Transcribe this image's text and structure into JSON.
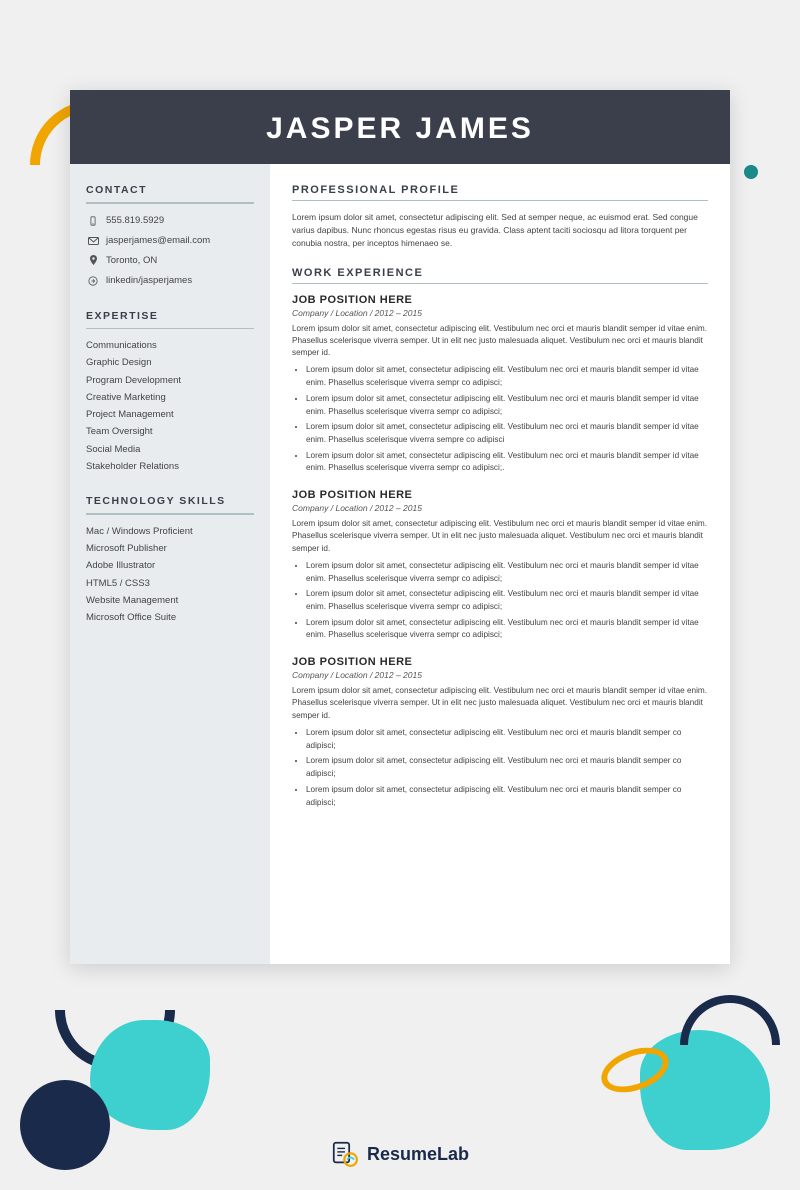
{
  "header": {
    "name": "JASPER JAMES"
  },
  "sidebar": {
    "contact_title": "CONTACT",
    "contact_items": [
      {
        "icon": "phone",
        "text": "555.819.5929"
      },
      {
        "icon": "email",
        "text": "jasperjames@email.com"
      },
      {
        "icon": "location",
        "text": "Toronto, ON"
      },
      {
        "icon": "linkedin",
        "text": "linkedin/jasperjames"
      }
    ],
    "expertise_title": "EXPERTISE",
    "expertise_items": [
      "Communications",
      "Graphic Design",
      "Program Development",
      "Creative Marketing",
      "Project Management",
      "Team Oversight",
      "Social Media",
      "Stakeholder Relations"
    ],
    "tech_title": "TECHNOLOGY SKILLS",
    "tech_items": [
      "Mac / Windows Proficient",
      "Microsoft Publisher",
      "Adobe Illustrator",
      "HTML5 / CSS3",
      "Website Management",
      "Microsoft Office Suite"
    ]
  },
  "main": {
    "profile_title": "PROFESSIONAL PROFILE",
    "profile_text": "Lorem ipsum dolor sit amet, consectetur adipiscing elit. Sed at semper neque, ac euismod erat. Sed congue varius dapibus. Nunc rhoncus egestas risus eu gravida. Class aptent taciti sociosqu ad litora torquent per conubia nostra, per inceptos himenaeo se.",
    "work_title": "WORK EXPERIENCE",
    "jobs": [
      {
        "title": "JOB POSITION HERE",
        "company": "Company / Location /  2012 – 2015",
        "description": "Lorem ipsum dolor sit amet, consectetur adipiscing elit. Vestibulum nec orci et mauris blandit semper id vitae enim. Phasellus scelerisque viverra semper. Ut in elit nec justo malesuada aliquet. Vestibulum nec orci et mauris blandit semper id.",
        "bullets": [
          "Lorem ipsum dolor sit amet, consectetur adipiscing elit. Vestibulum nec orci et mauris blandit semper id vitae enim. Phasellus scelerisque viverra sempr co adipisci;",
          "Lorem ipsum dolor sit amet, consectetur adipiscing elit. Vestibulum nec orci et mauris blandit semper id vitae enim. Phasellus scelerisque viverra sempr co adipisci;",
          "Lorem ipsum dolor sit amet, consectetur adipiscing elit. Vestibulum nec orci et mauris blandit semper id vitae enim. Phasellus scelerisque viverra sempre co adipisci",
          "Lorem ipsum dolor sit amet, consectetur adipiscing elit. Vestibulum nec orci et mauris blandit semper id vitae enim. Phasellus scelerisque viverra sempr co adipisci;."
        ]
      },
      {
        "title": "JOB POSITION HERE",
        "company": "Company / Location /  2012 – 2015",
        "description": "Lorem ipsum dolor sit amet, consectetur adipiscing elit. Vestibulum nec orci et mauris blandit semper id vitae enim. Phasellus scelerisque viverra semper. Ut in elit nec justo malesuada aliquet. Vestibulum nec orci et mauris blandit semper id.",
        "bullets": [
          "Lorem ipsum dolor sit amet, consectetur adipiscing elit. Vestibulum nec orci et mauris blandit semper id vitae enim. Phasellus scelerisque viverra sempr co adipisci;",
          "Lorem ipsum dolor sit amet, consectetur adipiscing elit. Vestibulum nec orci et mauris blandit semper id vitae enim. Phasellus scelerisque viverra sempr co adipisci;",
          "Lorem ipsum dolor sit amet, consectetur adipiscing elit. Vestibulum nec orci et mauris blandit semper id vitae enim. Phasellus scelerisque viverra sempr co adipisci;"
        ]
      },
      {
        "title": "JOB POSITION HERE",
        "company": "Company / Location /  2012 – 2015",
        "description": "Lorem ipsum dolor sit amet, consectetur adipiscing elit. Vestibulum nec orci et mauris blandit semper id vitae enim. Phasellus scelerisque viverra semper. Ut in elit nec justo malesuada aliquet. Vestibulum nec orci et mauris blandit semper id.",
        "bullets": [
          "Lorem ipsum dolor sit amet, consectetur adipiscing elit. Vestibulum nec orci et mauris blandit semper co adipisci;",
          "Lorem ipsum dolor sit amet, consectetur adipiscing elit. Vestibulum nec orci et mauris blandit semper co adipisci;",
          "Lorem ipsum dolor sit amet, consectetur adipiscing elit. Vestibulum nec orci et mauris blandit semper co adipisci;"
        ]
      }
    ]
  },
  "branding": {
    "name_plain": "Resume",
    "name_bold": "Lab"
  }
}
